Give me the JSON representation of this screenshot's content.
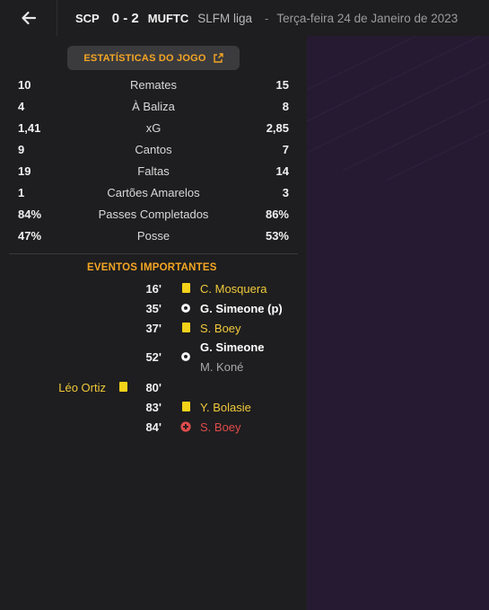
{
  "header": {
    "home_team": "SCP",
    "score": "0 - 2",
    "away_team": "MUFTC",
    "league": "SLFM liga",
    "separator": "-",
    "date": "Terça-feira 24 de Janeiro de 2023"
  },
  "stats_button": {
    "label": "ESTATÍSTICAS DO JOGO"
  },
  "stats": [
    {
      "home": "10",
      "label": "Remates",
      "away": "15"
    },
    {
      "home": "4",
      "label": "À Baliza",
      "away": "8"
    },
    {
      "home": "1,41",
      "label": "xG",
      "away": "2,85"
    },
    {
      "home": "9",
      "label": "Cantos",
      "away": "7"
    },
    {
      "home": "19",
      "label": "Faltas",
      "away": "14"
    },
    {
      "home": "1",
      "label": "Cartões Amarelos",
      "away": "3"
    },
    {
      "home": "84%",
      "label": "Passes Completados",
      "away": "86%"
    },
    {
      "home": "47%",
      "label": "Posse",
      "away": "53%"
    }
  ],
  "events": {
    "title": "EVENTOS IMPORTANTES",
    "items": [
      {
        "minute": "16'",
        "icon": "yellow-card-icon",
        "player": "C. Mosquera"
      },
      {
        "minute": "35'",
        "icon": "football-icon",
        "player": "G. Simeone (p)"
      },
      {
        "minute": "37'",
        "icon": "yellow-card-icon",
        "player": "S. Boey"
      },
      {
        "minute": "52'",
        "icon": "football-icon",
        "player": "G. Simeone",
        "assist": "M. Koné"
      },
      {
        "minute": "80'",
        "icon": "yellow-card-icon",
        "home_player": "Léo Ortiz"
      },
      {
        "minute": "83'",
        "icon": "yellow-card-icon",
        "player": "Y. Bolasie"
      },
      {
        "minute": "84'",
        "icon": "injury-icon",
        "player": "S. Boey"
      }
    ]
  },
  "colors": {
    "accent": "#f5a623",
    "panel": "#1e1e20",
    "right_panel": "#261a33",
    "yellow_card": "#f5d21a",
    "injury": "#e04b4b"
  }
}
